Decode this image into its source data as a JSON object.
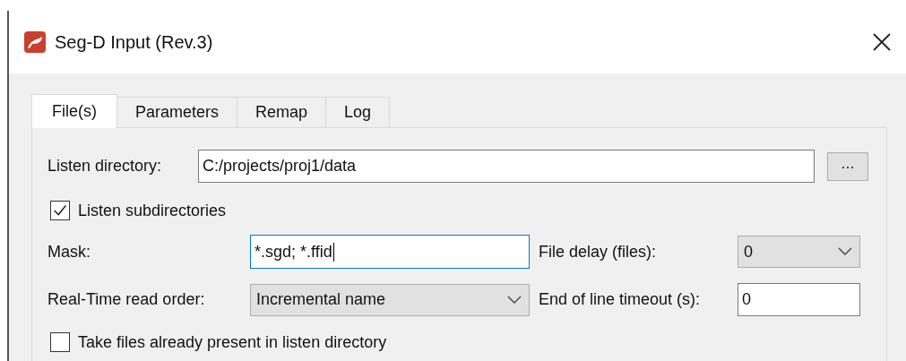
{
  "window": {
    "title": "Seg-D Input (Rev.3)"
  },
  "tabs": [
    {
      "label": "File(s)",
      "selected": true
    },
    {
      "label": "Parameters",
      "selected": false
    },
    {
      "label": "Remap",
      "selected": false
    },
    {
      "label": "Log",
      "selected": false
    }
  ],
  "listen_directory": {
    "label": "Listen directory:",
    "value": "C:/projects/proj1/data",
    "browse_button": "..."
  },
  "listen_subdirectories": {
    "label": "Listen subdirectories",
    "checked": true
  },
  "mask": {
    "label": "Mask:",
    "value": "*.sgd; *.ffid",
    "focused": true
  },
  "file_delay": {
    "label": "File delay (files):",
    "value": "0"
  },
  "read_order": {
    "label": "Real-Time read order:",
    "value": "Incremental name"
  },
  "end_of_line_timeout": {
    "label": "End of line timeout (s):",
    "value": "0"
  },
  "take_existing_files": {
    "label": "Take files already present in listen directory",
    "checked": false
  }
}
